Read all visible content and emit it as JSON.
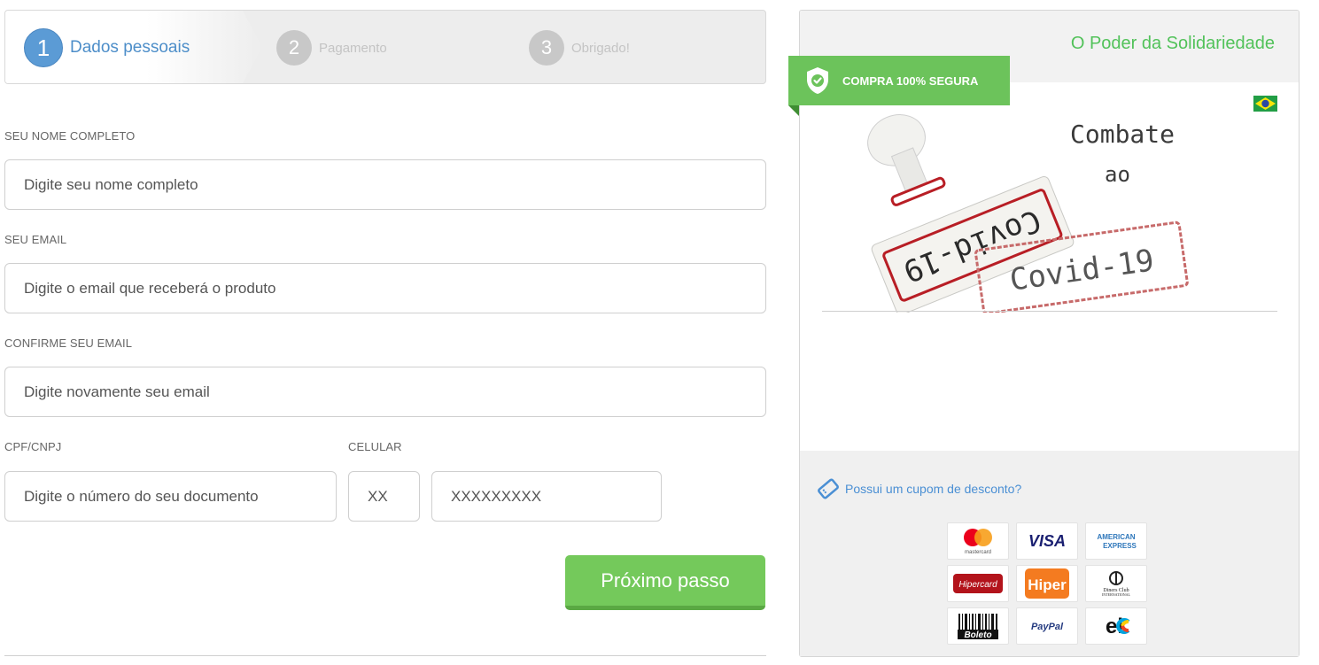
{
  "steps": [
    {
      "number": "1",
      "label": "Dados pessoais"
    },
    {
      "number": "2",
      "label": "Pagamento"
    },
    {
      "number": "3",
      "label": "Obrigado!"
    }
  ],
  "form": {
    "name_label": "SEU NOME COMPLETO",
    "name_placeholder": "Digite seu nome completo",
    "email_label": "SEU EMAIL",
    "email_placeholder": "Digite o email que receberá o produto",
    "confirm_label": "CONFIRME SEU EMAIL",
    "confirm_placeholder": "Digite novamente seu email",
    "doc_label": "CPF/CNPJ",
    "doc_placeholder": "Digite o número do seu documento",
    "phone_label": "CELULAR",
    "ddd_placeholder": "XX",
    "phone_placeholder": "XXXXXXXXX",
    "next_button": "Próximo passo"
  },
  "product": {
    "title": "O Poder da Solidariedade",
    "secure_badge": "COMPRA 100% SEGURA",
    "image_text": {
      "line1": "Combate",
      "line2": "ao",
      "stamp": "Covid-19",
      "roller": "Covid-19"
    },
    "coupon_link": "Possui um cupom de desconto?"
  },
  "payment_methods": [
    {
      "name": "mastercard",
      "label": "mastercard"
    },
    {
      "name": "visa",
      "label": "VISA"
    },
    {
      "name": "amex",
      "label": "AMERICAN EXPRESS"
    },
    {
      "name": "hipercard",
      "label": "Hipercard"
    },
    {
      "name": "hiper",
      "label": "Hiper"
    },
    {
      "name": "diners",
      "label": "Diners Club International"
    },
    {
      "name": "boleto",
      "label": "Boleto"
    },
    {
      "name": "paypal",
      "label": "PayPal"
    },
    {
      "name": "elo",
      "label": "elo"
    }
  ],
  "colors": {
    "accent_blue": "#5b9bd5",
    "green": "#74c95b",
    "title_green": "#52c25a",
    "link_blue": "#4a8fd4"
  }
}
